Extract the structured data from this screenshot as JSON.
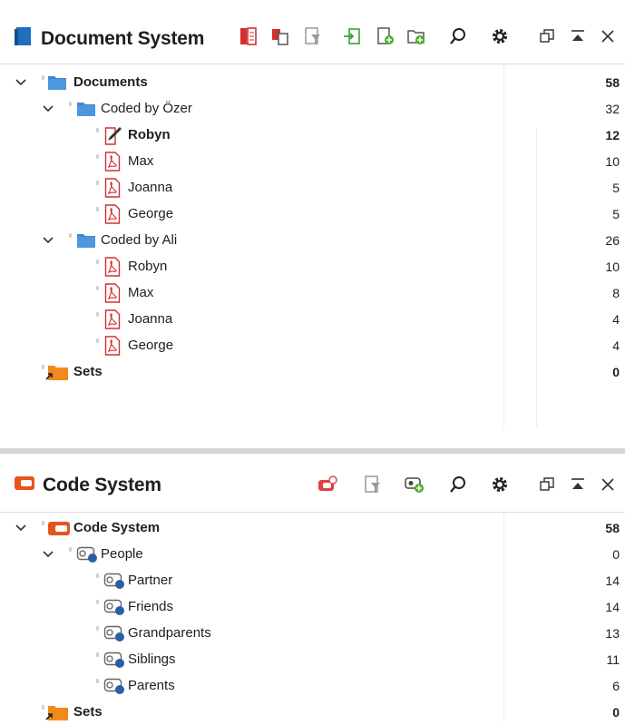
{
  "document_system": {
    "title": "Document System",
    "toolbar_icons": [
      "document-list-icon",
      "copy-documents-icon",
      "filter-icon",
      "import-icon",
      "new-document-icon",
      "new-folder-icon",
      "search-icon",
      "gear-icon",
      "undock-icon",
      "collapse-icon",
      "close-icon"
    ],
    "root": {
      "label": "Documents",
      "count": "58"
    },
    "groups": [
      {
        "label": "Coded by Özer",
        "count": "32",
        "docs": [
          {
            "label": "Robyn",
            "count": "12",
            "type": "text",
            "bold": true
          },
          {
            "label": "Max",
            "count": "10",
            "type": "pdf"
          },
          {
            "label": "Joanna",
            "count": "5",
            "type": "pdf"
          },
          {
            "label": "George",
            "count": "5",
            "type": "pdf"
          }
        ]
      },
      {
        "label": "Coded by Ali",
        "count": "26",
        "docs": [
          {
            "label": "Robyn",
            "count": "10",
            "type": "pdf"
          },
          {
            "label": "Max",
            "count": "8",
            "type": "pdf"
          },
          {
            "label": "Joanna",
            "count": "4",
            "type": "pdf"
          },
          {
            "label": "George",
            "count": "4",
            "type": "pdf"
          }
        ]
      }
    ],
    "sets": {
      "label": "Sets",
      "count": "0"
    }
  },
  "code_system": {
    "title": "Code System",
    "toolbar_icons": [
      "code-set-icon",
      "filter-icon",
      "new-code-icon",
      "search-icon",
      "gear-icon",
      "undock-icon",
      "collapse-icon",
      "close-icon"
    ],
    "root": {
      "label": "Code System",
      "count": "58"
    },
    "parent": {
      "label": "People",
      "count": "0"
    },
    "codes": [
      {
        "label": "Partner",
        "count": "14"
      },
      {
        "label": "Friends",
        "count": "14"
      },
      {
        "label": "Grandparents",
        "count": "13"
      },
      {
        "label": "Siblings",
        "count": "11"
      },
      {
        "label": "Parents",
        "count": "6"
      }
    ],
    "sets": {
      "label": "Sets",
      "count": "0"
    }
  },
  "colors": {
    "folder_blue": "#3b86d1",
    "pdf_red": "#d23030",
    "code_orange": "#e8531e",
    "sets_orange": "#f08a1c",
    "code_blue": "#2a5fa8"
  }
}
